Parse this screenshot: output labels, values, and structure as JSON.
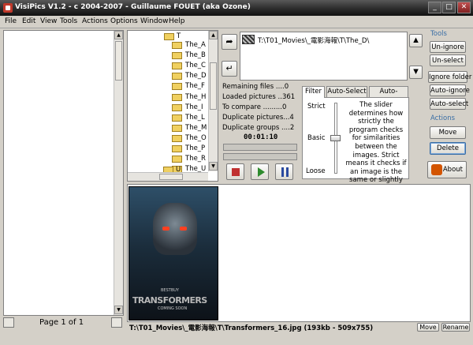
{
  "window": {
    "title": "VisiPics V1.2 - c 2004-2007 - Guillaume FOUET (aka Ozone)",
    "min": "_",
    "max": "□",
    "close": "✕"
  },
  "menu": [
    "File",
    "Edit",
    "View",
    "Tools",
    "Actions",
    "Options",
    "Window",
    "Help"
  ],
  "left_panel": {
    "page_label": "Page 1 of 1"
  },
  "tree": {
    "root": "T",
    "items": [
      "The_A",
      "The_B",
      "The_C",
      "The_D",
      "The_F",
      "The_H",
      "The_I",
      "The_L",
      "The_M",
      "The_O",
      "The_P",
      "The_R",
      "The_U"
    ],
    "partial": "U"
  },
  "path_bar": {
    "path": "T:\\T01_Movies\\_電影海報\\T\\The_D\\"
  },
  "stats": {
    "remaining": "Remaining files ....0",
    "loaded": "Loaded pictures ..361",
    "compare": "To compare .........0",
    "dup_pictures": "Duplicate pictures...4",
    "dup_groups": "Duplicate groups ....2",
    "timer": "00:01:10"
  },
  "tabs": {
    "filter": "Filter",
    "auto_select": "Auto-Select",
    "auto_ignore": "Auto-Ignore"
  },
  "filter": {
    "strict": "Strict",
    "basic": "Basic",
    "loose": "Loose",
    "description": "The slider determines how strictly the program checks for similarities between the images. Strict means it checks if an image is the same or slightly different, loose allows for a greater amount of differences.",
    "slider_fraction": 0.5
  },
  "tools": {
    "heading": "Tools",
    "unignore": "Un-ignore",
    "unselect": "Un-select",
    "ignore_folder": "Ignore folder",
    "auto_ignore": "Auto-ignore",
    "auto_select": "Auto-select"
  },
  "actions": {
    "heading": "Actions",
    "move": "Move",
    "delete": "Delete",
    "about": "About"
  },
  "poster": {
    "bestbuy": "BESTBUY",
    "title": "TRANSFORMERS",
    "tagline": "COMING SOON"
  },
  "status": {
    "file_info": "T:\\T01_Movies\\_電影海報\\T\\Transformers_16.jpg (193kb - 509x755)",
    "move": "Move",
    "rename": "Rename"
  },
  "colors": {
    "accent": "#3a6ea5",
    "stop": "#c03030",
    "play": "#2e8b2e",
    "pause": "#2a4aa0"
  }
}
